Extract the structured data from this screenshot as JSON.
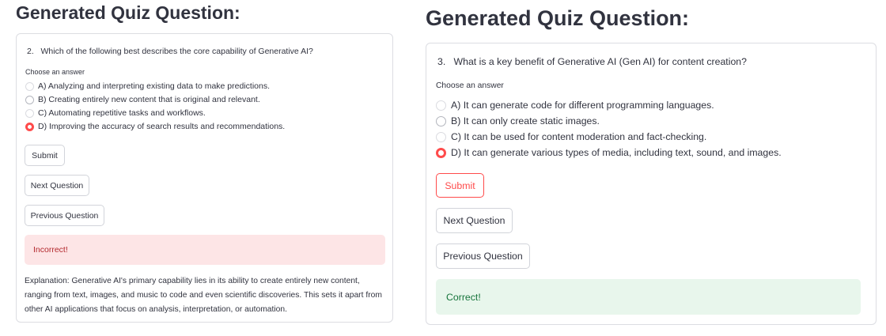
{
  "left": {
    "heading": "Generated Quiz Question:",
    "question": "2.   Which of the following best describes the core capability of Generative AI?",
    "choose_label": "Choose an answer",
    "options": [
      "A) Analyzing and interpreting existing data to make predictions.",
      "B) Creating entirely new content that is original and relevant.",
      "C) Automating repetitive tasks and workflows.",
      "D) Improving the accuracy of search results and recommendations."
    ],
    "selected_option": "D",
    "submit_label": "Submit",
    "next_label": "Next Question",
    "previous_label": "Previous Question",
    "result": "Incorrect!",
    "explanation": "Explanation: Generative AI's primary capability lies in its ability to create entirely new content, ranging from text, images, and music to code and even scientific discoveries. This sets it apart from other AI applications that focus on analysis, interpretation, or automation."
  },
  "right": {
    "heading": "Generated Quiz Question:",
    "question": "3.   What is a key benefit of Generative AI (Gen AI) for content creation?",
    "choose_label": "Choose an answer",
    "options": [
      "A) It can generate code for different programming languages.",
      "B) It can only create static images.",
      "C) It can be used for content moderation and fact-checking.",
      "D) It can generate various types of media, including text, sound, and images."
    ],
    "selected_option": "D",
    "submit_label": "Submit",
    "next_label": "Next Question",
    "previous_label": "Previous Question",
    "result": "Correct!"
  },
  "colors": {
    "accent": "#ff4b4b",
    "text": "#31333f",
    "error_bg": "#fde5e6",
    "error_text": "#b3282d",
    "success_bg": "#e8f6ec",
    "success_text": "#16743b"
  }
}
